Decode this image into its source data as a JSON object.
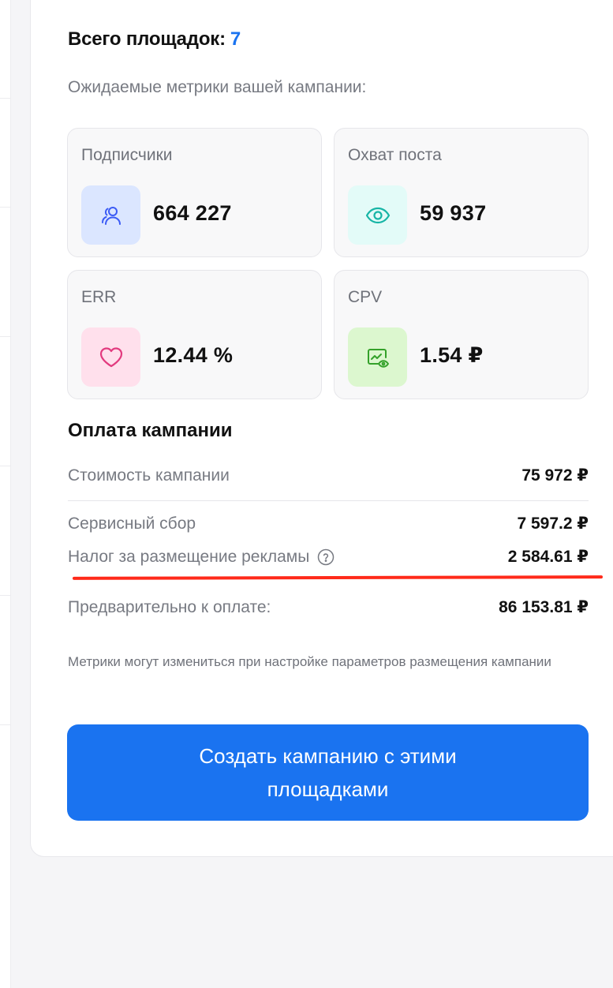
{
  "header": {
    "total_label": "Всего площадок:",
    "total_count": "7",
    "subtitle": "Ожидаемые метрики вашей кампании:"
  },
  "metrics": [
    {
      "label": "Подписчики",
      "value": "664 227",
      "icon": "users-icon",
      "icon_bg": "#dbe6ff",
      "icon_color": "#3b5bf5"
    },
    {
      "label": "Охват поста",
      "value": "59 937",
      "icon": "eye-icon",
      "icon_bg": "#e3fbf8",
      "icon_color": "#17b5a6"
    },
    {
      "label": "ERR",
      "value": "12.44 %",
      "icon": "heart-icon",
      "icon_bg": "#ffe0ec",
      "icon_color": "#e23a7e"
    },
    {
      "label": "CPV",
      "value": "1.54 ₽",
      "icon": "chart-eye-icon",
      "icon_bg": "#dcf7cf",
      "icon_color": "#34a12a"
    }
  ],
  "payment": {
    "title": "Оплата кампании",
    "rows": [
      {
        "label": "Стоимость кампании",
        "value": "75 972 ₽"
      },
      {
        "label": "Сервисный сбор",
        "value": "7 597.2 ₽"
      },
      {
        "label": "Налог за размещение рекламы",
        "value": "2 584.61 ₽"
      },
      {
        "label": "Предварительно к оплате:",
        "value": "86 153.81 ₽"
      }
    ]
  },
  "note": "Метрики могут измениться при настройке параметров размещения кампании",
  "cta": {
    "label": "Создать кампанию с этими площадками"
  },
  "colors": {
    "accent": "#1a73f0",
    "underline": "#ff2a1a"
  }
}
